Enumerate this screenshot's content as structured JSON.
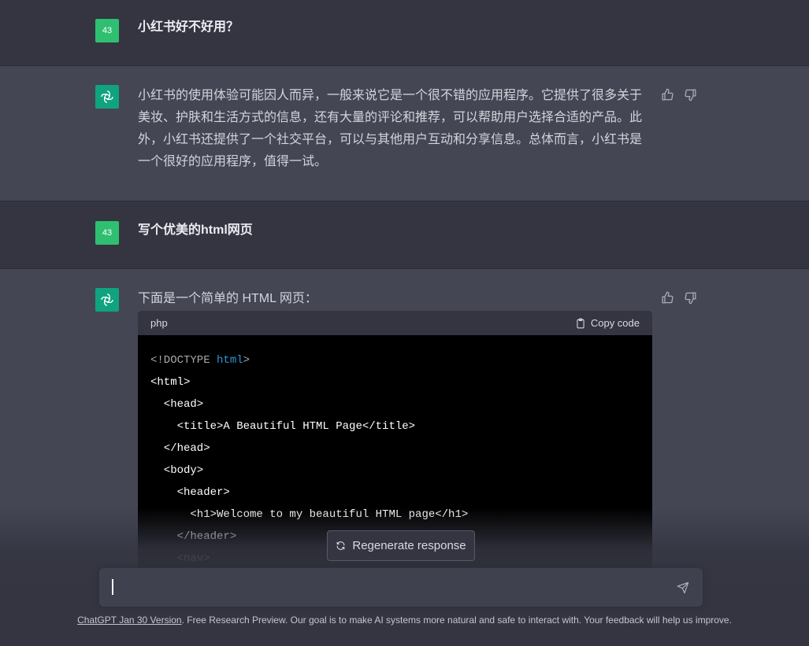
{
  "conversation": [
    {
      "role": "user",
      "avatar": "43",
      "text": "小红书好不好用？"
    },
    {
      "role": "assistant",
      "text": "小红书的使用体验可能因人而异，一般来说它是一个很不错的应用程序。它提供了很多关于美妆、护肤和生活方式的信息，还有大量的评论和推荐，可以帮助用户选择合适的产品。此外，小红书还提供了一个社交平台，可以与其他用户互动和分享信息。总体而言，小红书是一个很好的应用程序，值得一试。"
    },
    {
      "role": "user",
      "avatar": "43",
      "text": "写个优美的html网页"
    },
    {
      "role": "assistant",
      "intro": "下面是一个简单的 HTML 网页：",
      "code": {
        "language": "php",
        "copy_label": "Copy code",
        "lines": [
          "<!DOCTYPE html>",
          "<html>",
          "  <head>",
          "    <title>A Beautiful HTML Page</title>",
          "  </head>",
          "  <body>",
          "    <header>",
          "      <h1>Welcome to my beautiful HTML page</h1>",
          "    </header>",
          "    <nav>"
        ]
      }
    }
  ],
  "regenerate_label": "Regenerate response",
  "footer": {
    "link": "ChatGPT Jan 30 Version",
    "text": ". Free Research Preview. Our goal is to make AI systems more natural and safe to interact with. Your feedback will help us improve."
  },
  "colors": {
    "user_avatar": "#2fbf71",
    "assistant_avatar": "#10a37f",
    "code_keyword": "#2e95d3"
  }
}
